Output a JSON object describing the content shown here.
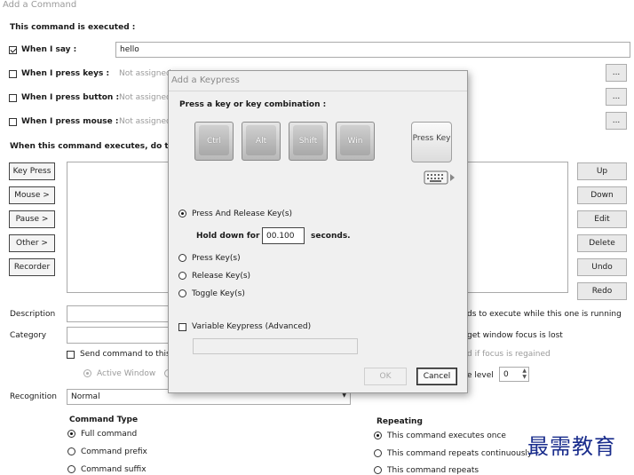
{
  "window_title": "Add a Command",
  "section_title": "This command is executed :",
  "triggers": [
    {
      "label": "When I say :",
      "checked": true,
      "value": "hello"
    },
    {
      "label": "When I press keys :",
      "checked": false,
      "value": "Not assigned"
    },
    {
      "label": "When I press button :",
      "checked": false,
      "value": "Not assigned"
    },
    {
      "label": "When I press mouse :",
      "checked": false,
      "value": "Not assigned"
    }
  ],
  "ellipsis": "...",
  "action_header": "When this command executes, do the f",
  "left_buttons": [
    "Key Press",
    "Mouse >",
    "Pause >",
    "Other >",
    "Recorder"
  ],
  "right_buttons": [
    "Up",
    "Down",
    "Edit",
    "Delete",
    "Undo",
    "Redo"
  ],
  "description_label": "Description",
  "category_label": "Category",
  "send_command_label": "Send command to this",
  "active_window_label": "Active Window",
  "right_options": {
    "commands_running": "ds to execute while this one is running",
    "focus_lost": "get window focus is lost",
    "focus_regained": "d if focus is regained",
    "level_label": "e level",
    "level_value": "0"
  },
  "recognition_label": "Recognition",
  "recognition_value": "Normal",
  "command_type": {
    "title": "Command Type",
    "options": [
      "Full command",
      "Command prefix",
      "Command suffix"
    ],
    "selected": 0
  },
  "repeating": {
    "title": "Repeating",
    "options": [
      "This command executes once",
      "This command repeats continuously",
      "This command repeats"
    ],
    "selected": 0
  },
  "watermark": "最需教育",
  "dialog": {
    "title": "Add a Keypress",
    "prompt": "Press a key or key combination :",
    "modifier_keys": [
      "Ctrl",
      "Alt",
      "Shift",
      "Win"
    ],
    "press_key_button": "Press Key",
    "mode_options": [
      "Press And Release Key(s)",
      "Press Key(s)",
      "Release Key(s)",
      "Toggle Key(s)"
    ],
    "mode_selected": 0,
    "hold_label": "Hold down for",
    "hold_value": "00.100",
    "seconds_label": "seconds.",
    "variable_label": "Variable Keypress (Advanced)",
    "ok_label": "OK",
    "cancel_label": "Cancel"
  }
}
